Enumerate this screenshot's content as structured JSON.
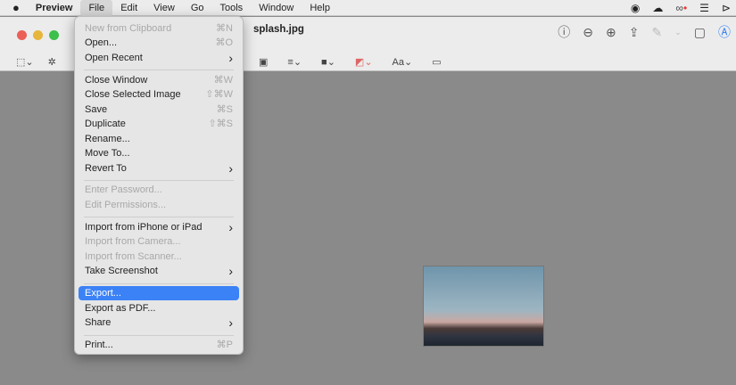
{
  "menubar": {
    "items": [
      "Preview",
      "File",
      "Edit",
      "View",
      "Go",
      "Tools",
      "Window",
      "Help"
    ]
  },
  "window": {
    "title": "splash.jpg",
    "traffic": [
      "#ec5f57",
      "#e6b53a",
      "#3cbf4b"
    ]
  },
  "toolbar": {
    "right_icons": [
      "info-icon",
      "zoom-out-icon",
      "zoom-in-icon",
      "share-icon",
      "markup-pen-icon",
      "chevron-down-icon",
      "rotate-icon",
      "annotate-icon"
    ],
    "font_label": "Aa"
  },
  "file_menu": [
    {
      "label": "New from Clipboard",
      "shortcut": "⌘N",
      "disabled": true
    },
    {
      "label": "Open...",
      "shortcut": "⌘O"
    },
    {
      "label": "Open Recent",
      "submenu": true
    },
    {
      "label": "Close Window",
      "shortcut": "⌘W"
    },
    {
      "label": "Close Selected Image",
      "shortcut": "⇧⌘W"
    },
    {
      "label": "Save",
      "shortcut": "⌘S"
    },
    {
      "label": "Duplicate",
      "shortcut": "⇧⌘S"
    },
    {
      "label": "Rename..."
    },
    {
      "label": "Move To..."
    },
    {
      "label": "Revert To",
      "submenu": true
    },
    {
      "label": "Enter Password...",
      "disabled": true
    },
    {
      "label": "Edit Permissions...",
      "disabled": true
    },
    {
      "label": "Import from iPhone or iPad",
      "submenu": true
    },
    {
      "label": "Import from Camera...",
      "disabled": true
    },
    {
      "label": "Import from Scanner...",
      "disabled": true
    },
    {
      "label": "Take Screenshot",
      "submenu": true
    },
    {
      "label": "Export...",
      "highlighted": true
    },
    {
      "label": "Export as PDF..."
    },
    {
      "label": "Share",
      "submenu": true
    },
    {
      "label": "Print...",
      "shortcut": "⌘P"
    }
  ]
}
